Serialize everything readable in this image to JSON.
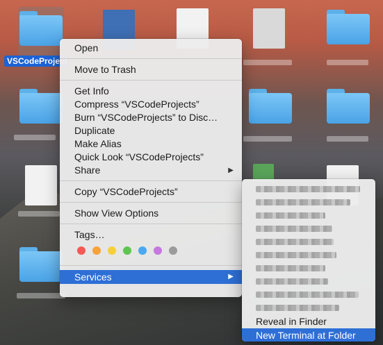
{
  "desktop": {
    "selected_item_label": "VSCodeProjects"
  },
  "context_menu": {
    "items_group1": [
      "Open"
    ],
    "items_group2": [
      "Move to Trash"
    ],
    "items_group3": [
      "Get Info",
      "Compress “VSCodeProjects”",
      "Burn “VSCodeProjects” to Disc…",
      "Duplicate",
      "Make Alias",
      "Quick Look “VSCodeProjects”"
    ],
    "share_label": "Share",
    "copy_label": "Copy “VSCodeProjects”",
    "view_options_label": "Show View Options",
    "tags_label": "Tags…",
    "tag_colors": [
      "#f45a55",
      "#f7a23a",
      "#f6d03b",
      "#5ec64f",
      "#4aa9f0",
      "#c678e0",
      "#9b9b9b"
    ],
    "services_label": "Services"
  },
  "services_submenu": {
    "blurred_item_count_note": "",
    "reveal_label": "Reveal in Finder",
    "terminal_label": "New Terminal at Folder"
  },
  "colors": {
    "highlight": "#2e6fd6",
    "selection_label": "#1b63d6"
  }
}
